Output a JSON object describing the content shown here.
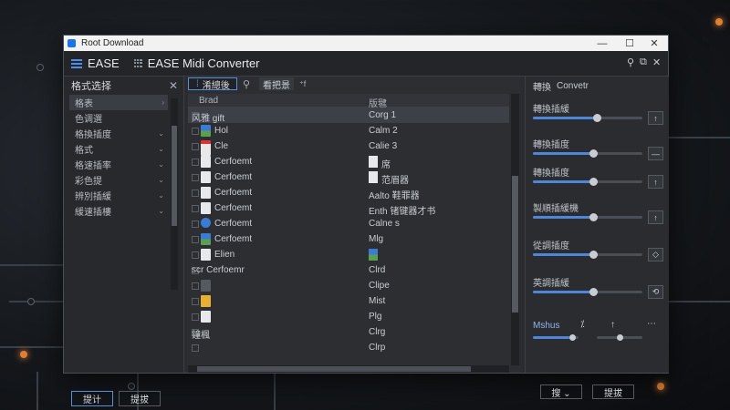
{
  "window": {
    "title": "Root Download"
  },
  "app": {
    "brand": "EASE",
    "title": "EASE Midi Converter"
  },
  "left_panel": {
    "title": "格式选择",
    "items": [
      {
        "label": "格表",
        "selected": true,
        "chevron": "›"
      },
      {
        "label": "色调選",
        "selected": false,
        "chevron": ""
      },
      {
        "label": "格換插度",
        "selected": false,
        "chevron": "⌄"
      },
      {
        "label": "格式",
        "selected": false,
        "chevron": "⌄"
      },
      {
        "label": "格速插率",
        "selected": false,
        "chevron": "⌄"
      },
      {
        "label": "彩色提",
        "selected": false,
        "chevron": "⌄"
      },
      {
        "label": "辨別插緩",
        "selected": false,
        "chevron": "⌄"
      },
      {
        "label": "緩速插樓",
        "selected": false,
        "chevron": "⌄"
      }
    ],
    "btn_primary": "提计",
    "btn_secondary": "提拔"
  },
  "middle_panel": {
    "search_value": "淆總後",
    "toolbar_label": "看把景",
    "toolbar_extra": "⁺f",
    "columns": [
      "Brad",
      "版毽"
    ],
    "rows": [
      {
        "name": "风雅 gift",
        "ctype": "Corg 1",
        "selected": true,
        "icon": "none",
        "cicon": "none"
      },
      {
        "name": "Hol",
        "ctype": "Calm 2",
        "selected": false,
        "icon": "image",
        "cicon": "none"
      },
      {
        "name": "Cle",
        "ctype": "Calie 3",
        "selected": false,
        "icon": "pdf",
        "cicon": "none"
      },
      {
        "name": "Cerfoemt",
        "ctype": "席",
        "selected": false,
        "icon": "doc",
        "cicon": "doc"
      },
      {
        "name": "Cerfoemt",
        "ctype": "范眉器",
        "selected": false,
        "icon": "doc",
        "cicon": "doc"
      },
      {
        "name": "Cerfoemt",
        "ctype": "Aalto 鞋罪器",
        "selected": false,
        "icon": "doc",
        "cicon": "none"
      },
      {
        "name": "Cerfoemt",
        "ctype": "Enth 锗键器才书",
        "selected": false,
        "icon": "doc",
        "cicon": "none"
      },
      {
        "name": "Cerfoemt",
        "ctype": "Calne s",
        "selected": false,
        "icon": "globe",
        "cicon": "none"
      },
      {
        "name": "Cerfoemt",
        "ctype": "Mlg",
        "selected": false,
        "icon": "image",
        "cicon": "none"
      },
      {
        "name": "Elien",
        "ctype": "",
        "selected": false,
        "icon": "doc",
        "cicon": "image"
      },
      {
        "name": "scr Cerfoemr",
        "ctype": "Clrd",
        "selected": false,
        "icon": "none",
        "cicon": "none"
      },
      {
        "name": "",
        "ctype": "Clipe",
        "selected": false,
        "icon": "film",
        "cicon": "none"
      },
      {
        "name": "",
        "ctype": "Mist",
        "selected": false,
        "icon": "zip",
        "cicon": "none"
      },
      {
        "name": "",
        "ctype": "Plg",
        "selected": false,
        "icon": "doc",
        "cicon": "none"
      },
      {
        "name": "鐘楓",
        "ctype": "Clrg",
        "selected": false,
        "icon": "none",
        "cicon": "none"
      },
      {
        "name": "",
        "ctype": "Clrp",
        "selected": false,
        "icon": "none",
        "cicon": "none"
      }
    ]
  },
  "right_panel": {
    "title_a": "轉換",
    "title_b": "Convetr",
    "settings": [
      {
        "label": "轉換插緩",
        "level": 0.58,
        "button": "↑"
      },
      {
        "label": "轉換插度",
        "level": 0.55,
        "button": "—"
      },
      {
        "label": "轉換插度",
        "level": 0.55,
        "button": "↑"
      },
      {
        "label": "製順插緩機",
        "level": 0.55,
        "button": "↑"
      },
      {
        "label": "從調插度",
        "level": 0.55,
        "button": "◇"
      },
      {
        "label": "英調插緩",
        "level": 0.55,
        "button": "⟲"
      }
    ],
    "footer_label": "Mshus",
    "footer_icons": [
      "⁒",
      "↑",
      "⋯"
    ],
    "btn_left": "搜 ⌄",
    "btn_right": "提拔"
  },
  "colors": {
    "accent": "#4f86d8",
    "window_bg": "#2a2c30"
  }
}
